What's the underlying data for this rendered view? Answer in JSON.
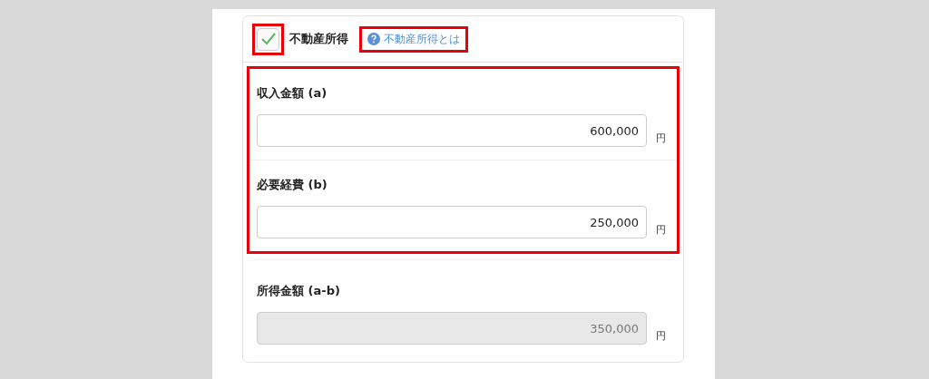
{
  "header": {
    "checkbox": {
      "checked": true,
      "highlighted": true
    },
    "title": "不動産所得",
    "help_link": {
      "text": "不動産所得とは",
      "highlighted": true
    }
  },
  "sections": [
    {
      "highlighted": true,
      "fields": [
        {
          "label": "収入金額 (a)",
          "value": "600,000",
          "unit": "円",
          "disabled": false
        },
        {
          "label": "必要経費 (b)",
          "value": "250,000",
          "unit": "円",
          "disabled": false
        }
      ]
    },
    {
      "highlighted": false,
      "fields": [
        {
          "label": "所得金額 (a-b)",
          "value": "350,000",
          "unit": "円",
          "disabled": true
        }
      ]
    }
  ]
}
